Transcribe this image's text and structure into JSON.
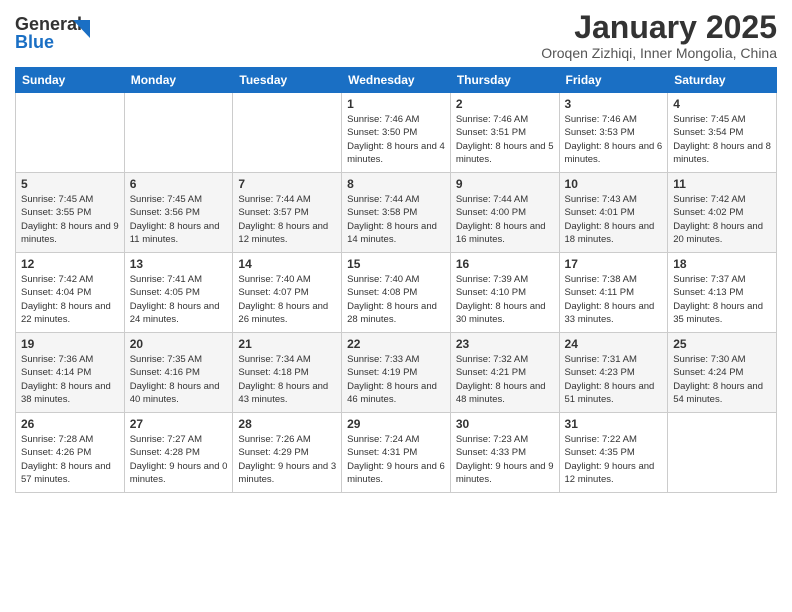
{
  "header": {
    "logo_general": "General",
    "logo_blue": "Blue",
    "title": "January 2025",
    "subtitle": "Oroqen Zizhiqi, Inner Mongolia, China"
  },
  "weekdays": [
    "Sunday",
    "Monday",
    "Tuesday",
    "Wednesday",
    "Thursday",
    "Friday",
    "Saturday"
  ],
  "weeks": [
    [
      {
        "day": "",
        "info": ""
      },
      {
        "day": "",
        "info": ""
      },
      {
        "day": "",
        "info": ""
      },
      {
        "day": "1",
        "info": "Sunrise: 7:46 AM\nSunset: 3:50 PM\nDaylight: 8 hours\nand 4 minutes."
      },
      {
        "day": "2",
        "info": "Sunrise: 7:46 AM\nSunset: 3:51 PM\nDaylight: 8 hours\nand 5 minutes."
      },
      {
        "day": "3",
        "info": "Sunrise: 7:46 AM\nSunset: 3:53 PM\nDaylight: 8 hours\nand 6 minutes."
      },
      {
        "day": "4",
        "info": "Sunrise: 7:45 AM\nSunset: 3:54 PM\nDaylight: 8 hours\nand 8 minutes."
      }
    ],
    [
      {
        "day": "5",
        "info": "Sunrise: 7:45 AM\nSunset: 3:55 PM\nDaylight: 8 hours\nand 9 minutes."
      },
      {
        "day": "6",
        "info": "Sunrise: 7:45 AM\nSunset: 3:56 PM\nDaylight: 8 hours\nand 11 minutes."
      },
      {
        "day": "7",
        "info": "Sunrise: 7:44 AM\nSunset: 3:57 PM\nDaylight: 8 hours\nand 12 minutes."
      },
      {
        "day": "8",
        "info": "Sunrise: 7:44 AM\nSunset: 3:58 PM\nDaylight: 8 hours\nand 14 minutes."
      },
      {
        "day": "9",
        "info": "Sunrise: 7:44 AM\nSunset: 4:00 PM\nDaylight: 8 hours\nand 16 minutes."
      },
      {
        "day": "10",
        "info": "Sunrise: 7:43 AM\nSunset: 4:01 PM\nDaylight: 8 hours\nand 18 minutes."
      },
      {
        "day": "11",
        "info": "Sunrise: 7:42 AM\nSunset: 4:02 PM\nDaylight: 8 hours\nand 20 minutes."
      }
    ],
    [
      {
        "day": "12",
        "info": "Sunrise: 7:42 AM\nSunset: 4:04 PM\nDaylight: 8 hours\nand 22 minutes."
      },
      {
        "day": "13",
        "info": "Sunrise: 7:41 AM\nSunset: 4:05 PM\nDaylight: 8 hours\nand 24 minutes."
      },
      {
        "day": "14",
        "info": "Sunrise: 7:40 AM\nSunset: 4:07 PM\nDaylight: 8 hours\nand 26 minutes."
      },
      {
        "day": "15",
        "info": "Sunrise: 7:40 AM\nSunset: 4:08 PM\nDaylight: 8 hours\nand 28 minutes."
      },
      {
        "day": "16",
        "info": "Sunrise: 7:39 AM\nSunset: 4:10 PM\nDaylight: 8 hours\nand 30 minutes."
      },
      {
        "day": "17",
        "info": "Sunrise: 7:38 AM\nSunset: 4:11 PM\nDaylight: 8 hours\nand 33 minutes."
      },
      {
        "day": "18",
        "info": "Sunrise: 7:37 AM\nSunset: 4:13 PM\nDaylight: 8 hours\nand 35 minutes."
      }
    ],
    [
      {
        "day": "19",
        "info": "Sunrise: 7:36 AM\nSunset: 4:14 PM\nDaylight: 8 hours\nand 38 minutes."
      },
      {
        "day": "20",
        "info": "Sunrise: 7:35 AM\nSunset: 4:16 PM\nDaylight: 8 hours\nand 40 minutes."
      },
      {
        "day": "21",
        "info": "Sunrise: 7:34 AM\nSunset: 4:18 PM\nDaylight: 8 hours\nand 43 minutes."
      },
      {
        "day": "22",
        "info": "Sunrise: 7:33 AM\nSunset: 4:19 PM\nDaylight: 8 hours\nand 46 minutes."
      },
      {
        "day": "23",
        "info": "Sunrise: 7:32 AM\nSunset: 4:21 PM\nDaylight: 8 hours\nand 48 minutes."
      },
      {
        "day": "24",
        "info": "Sunrise: 7:31 AM\nSunset: 4:23 PM\nDaylight: 8 hours\nand 51 minutes."
      },
      {
        "day": "25",
        "info": "Sunrise: 7:30 AM\nSunset: 4:24 PM\nDaylight: 8 hours\nand 54 minutes."
      }
    ],
    [
      {
        "day": "26",
        "info": "Sunrise: 7:28 AM\nSunset: 4:26 PM\nDaylight: 8 hours\nand 57 minutes."
      },
      {
        "day": "27",
        "info": "Sunrise: 7:27 AM\nSunset: 4:28 PM\nDaylight: 9 hours\nand 0 minutes."
      },
      {
        "day": "28",
        "info": "Sunrise: 7:26 AM\nSunset: 4:29 PM\nDaylight: 9 hours\nand 3 minutes."
      },
      {
        "day": "29",
        "info": "Sunrise: 7:24 AM\nSunset: 4:31 PM\nDaylight: 9 hours\nand 6 minutes."
      },
      {
        "day": "30",
        "info": "Sunrise: 7:23 AM\nSunset: 4:33 PM\nDaylight: 9 hours\nand 9 minutes."
      },
      {
        "day": "31",
        "info": "Sunrise: 7:22 AM\nSunset: 4:35 PM\nDaylight: 9 hours\nand 12 minutes."
      },
      {
        "day": "",
        "info": ""
      }
    ]
  ]
}
